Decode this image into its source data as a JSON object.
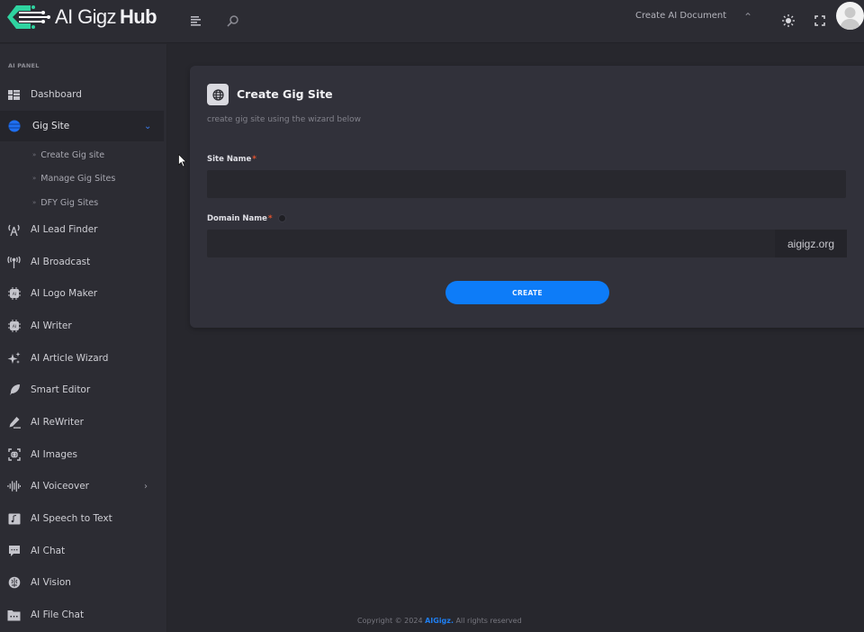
{
  "header": {
    "brand_prefix": "AI Gigz",
    "brand_suffix": "Hub",
    "menu_icon": "menu-lines-icon",
    "search_icon": "search-icon",
    "create_doc_label": "Create AI Document",
    "theme_icon": "sun-icon",
    "fullscreen_icon": "fullscreen-icon",
    "avatar_icon": "user-avatar"
  },
  "sidebar": {
    "panel_label": "AI PANEL",
    "items": [
      {
        "label": "Dashboard",
        "icon": "dashboard-icon"
      },
      {
        "label": "Gig Site",
        "icon": "globe-icon",
        "expanded": true
      },
      {
        "label": "AI Lead Finder",
        "icon": "antenna-icon"
      },
      {
        "label": "AI Broadcast",
        "icon": "broadcast-icon"
      },
      {
        "label": "AI Logo Maker",
        "icon": "ai-chip-icon"
      },
      {
        "label": "AI Writer",
        "icon": "ai-chip-icon"
      },
      {
        "label": "AI Article Wizard",
        "icon": "sparkles-icon"
      },
      {
        "label": "Smart Editor",
        "icon": "feather-icon"
      },
      {
        "label": "AI ReWriter",
        "icon": "pencil-icon"
      },
      {
        "label": "AI Images",
        "icon": "image-scan-icon"
      },
      {
        "label": "AI Voiceover",
        "icon": "waveform-icon",
        "has_submenu": true
      },
      {
        "label": "AI Speech to Text",
        "icon": "audio-file-icon"
      },
      {
        "label": "AI Chat",
        "icon": "chat-bubble-icon"
      },
      {
        "label": "AI Vision",
        "icon": "brain-icon"
      },
      {
        "label": "AI File Chat",
        "icon": "folder-chat-icon"
      }
    ],
    "sub_items": [
      {
        "label": "Create Gig site"
      },
      {
        "label": "Manage Gig Sites"
      },
      {
        "label": "DFY Gig Sites"
      }
    ]
  },
  "main": {
    "card_title": "Create Gig Site",
    "card_subtitle": "create gig site using the wizard below",
    "site_name_label": "Site Name",
    "site_name_value": "",
    "domain_name_label": "Domain Name",
    "domain_name_value": "",
    "domain_suffix": "aigigz.org",
    "required_mark": "*",
    "create_button": "CREATE"
  },
  "footer": {
    "prefix": "Copyright © 2024 ",
    "brand": "AIGigz.",
    "suffix": " All rights reserved"
  },
  "colors": {
    "accent": "#0d7cf8",
    "logo": "#2fd3a0",
    "required": "#e2522e",
    "background": "#27272d",
    "sidebar": "#2c2c33",
    "card": "#31313a"
  }
}
